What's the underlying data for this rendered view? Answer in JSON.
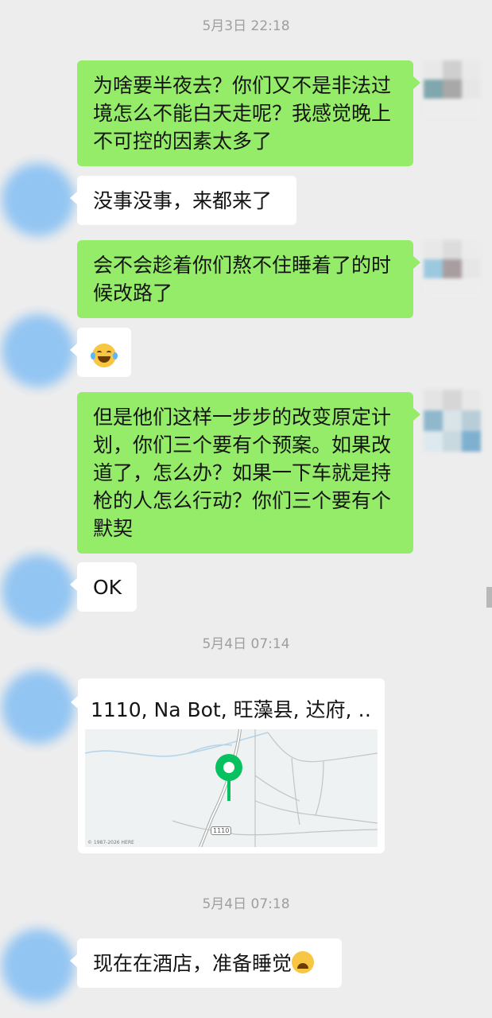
{
  "timestamps": [
    "5月3日 22:18",
    "5月4日 07:14",
    "5月4日 07:18"
  ],
  "messages": {
    "m1": {
      "lines": [
        "为啥要半夜去？你们又不是非法过",
        "境怎么不能白天走呢？我感觉晚上",
        "不可控的因素太多了"
      ]
    },
    "m2": {
      "text": "没事没事，来都来了"
    },
    "m3": {
      "lines": [
        "会不会趁着你们熬不住睡着了的时",
        "候改路了"
      ]
    },
    "m4": {
      "emoji": "laughing-crying-emoji"
    },
    "m5": {
      "lines": [
        "但是他们这样一步步的改变原定计",
        "划，你们三个要有个预案。如果改",
        "道了，怎么办？如果一下车就是持",
        "枪的人怎么行动？你们三个要有个",
        "默契"
      ]
    },
    "m6": {
      "text": "OK"
    },
    "m7": {
      "location_title": "1110, Na Bot, 旺藻县, 达府, …",
      "map_copyright": "© 1987-2026 HERE",
      "road_label": "1110"
    },
    "m8": {
      "text": "现在在酒店，准备睡觉",
      "emoji": "loudly-crying-emoji"
    }
  },
  "colors": {
    "background": "#ededed",
    "sent_bubble": "#95ec69",
    "received_bubble": "#ffffff",
    "timestamp": "#9e9e9e",
    "map_pin": "#07c160"
  }
}
